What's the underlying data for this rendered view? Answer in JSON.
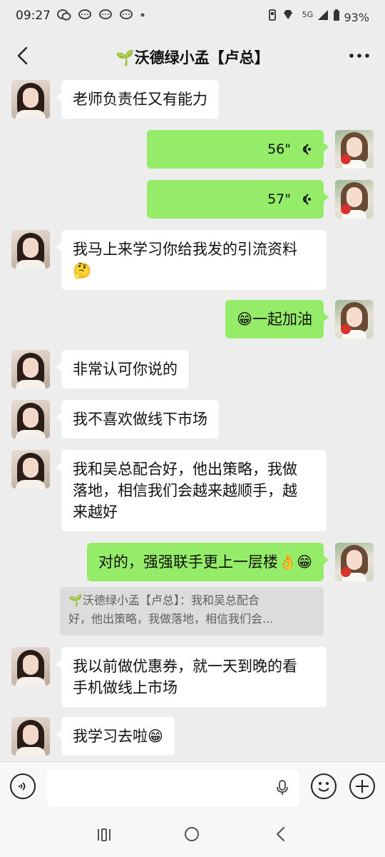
{
  "status_bar": {
    "time": "09:27",
    "network": "5G",
    "battery": "93%"
  },
  "header": {
    "title": "🌱沃德绿小孟【卢总】"
  },
  "messages": [
    {
      "side": "left",
      "text": "老师负责任又有能力"
    },
    {
      "side": "right",
      "type": "voice",
      "duration": "56\""
    },
    {
      "side": "right",
      "type": "voice",
      "duration": "57\""
    },
    {
      "side": "left",
      "text_line1": "我马上来学习你给我发的引流资料",
      "emoji": "🤔"
    },
    {
      "side": "right",
      "emoji": "😁",
      "text": "一起加油"
    },
    {
      "side": "left",
      "text": "非常认可你说的"
    },
    {
      "side": "left",
      "text": "我不喜欢做线下市场"
    },
    {
      "side": "left",
      "text_line1": "我和吴总配合好，他出策略，我做",
      "text_line2": "落地，相信我们会越来越顺手，越",
      "text_line3": "来越好"
    },
    {
      "side": "right",
      "text": "对的，强强联手更上一层楼",
      "emoji1": "👌",
      "emoji2": "😁"
    },
    {
      "side": "quote",
      "line1": "🌱沃德绿小孟【卢总】：我和吴总配合",
      "line2": "好，他出策略，我做落地，相信我们会..."
    },
    {
      "side": "left",
      "text_line1": "我以前做优惠券，就一天到晚的看",
      "text_line2": "手机做线上市场"
    },
    {
      "side": "left",
      "text": "我学习去啦",
      "emoji": "😁"
    }
  ],
  "colors": {
    "background": "#ededed",
    "self_bubble": "#95ec69",
    "other_bubble": "#ffffff"
  }
}
